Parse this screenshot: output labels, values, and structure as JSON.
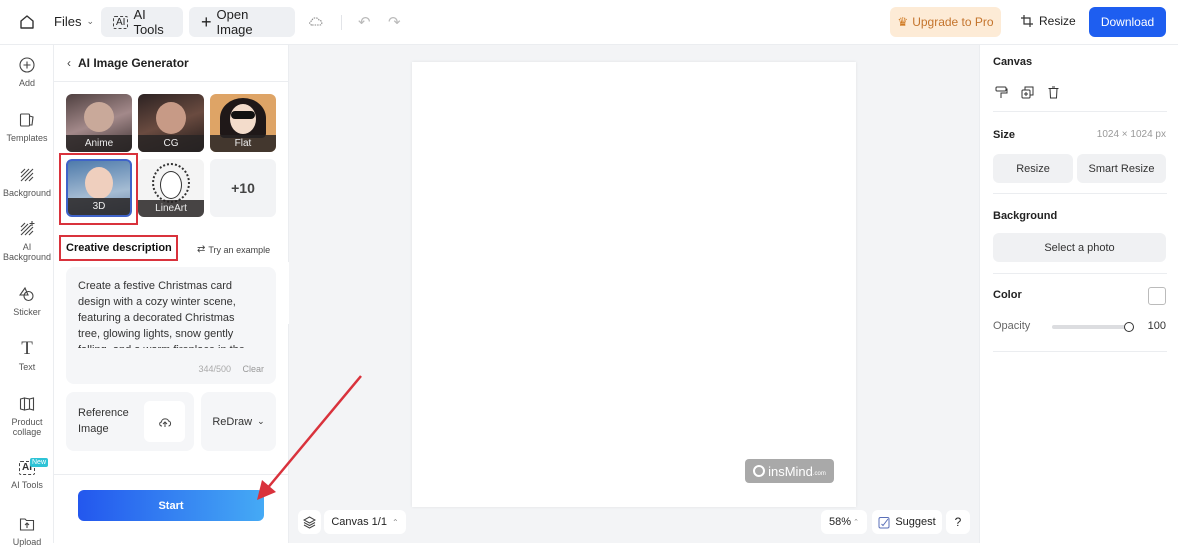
{
  "topbar": {
    "files_label": "Files",
    "ai_tools_label": "AI Tools",
    "open_image_label": "Open Image",
    "upgrade_label": "Upgrade to Pro",
    "resize_label": "Resize",
    "download_label": "Download"
  },
  "leftnav": {
    "items": [
      {
        "label": "Add",
        "icon": "plus-circle-icon"
      },
      {
        "label": "Templates",
        "icon": "templates-icon"
      },
      {
        "label": "Background",
        "icon": "background-icon"
      },
      {
        "label": "AI Background",
        "icon": "ai-background-icon"
      },
      {
        "label": "Sticker",
        "icon": "sticker-icon"
      },
      {
        "label": "Text",
        "icon": "text-icon"
      },
      {
        "label": "Product collage",
        "icon": "collage-icon"
      },
      {
        "label": "AI Tools",
        "icon": "ai-tools-icon",
        "badge": "New"
      },
      {
        "label": "Upload",
        "icon": "upload-icon"
      }
    ]
  },
  "panel": {
    "title": "AI Image Generator",
    "styles": [
      {
        "label": "Anime",
        "colors": [
          "#6b5a5a",
          "#a48c8c"
        ]
      },
      {
        "label": "CG",
        "colors": [
          "#3a2c2c",
          "#8e6a5c"
        ]
      },
      {
        "label": "Flat",
        "colors": [
          "#d9a06b",
          "#2a2020"
        ]
      },
      {
        "label": "3D",
        "colors": [
          "#5b87b4",
          "#d8c2b5"
        ],
        "selected": true
      },
      {
        "label": "LineArt",
        "colors": [
          "#ffffff",
          "#444444"
        ]
      }
    ],
    "more_label": "+10",
    "creative_label": "Creative description",
    "try_example_label": "Try an example",
    "description": "Create a festive Christmas card design with a cozy winter scene, featuring a decorated Christmas tree, glowing lights, snow gently falling, and a warm fireplace in the",
    "char_count": "344/500",
    "clear_label": "Clear",
    "reference_label": "Reference Image",
    "redraw_label": "ReDraw",
    "start_label": "Start"
  },
  "canvas": {
    "watermark": "insMind",
    "watermark_suffix": ".com",
    "page_label": "Canvas 1/1",
    "zoom_label": "58%",
    "suggest_label": "Suggest",
    "help_label": "?"
  },
  "rightpanel": {
    "canvas_title": "Canvas",
    "size_label": "Size",
    "size_value": "1024 × 1024 px",
    "resize_label": "Resize",
    "smart_resize_label": "Smart Resize",
    "background_label": "Background",
    "select_photo_label": "Select a photo",
    "color_label": "Color",
    "opacity_label": "Opacity",
    "opacity_value": "100"
  },
  "colors": {
    "accent": "#1e5ef0",
    "annotation_red": "#d9323c",
    "upgrade_bg": "#fdebd6",
    "upgrade_text": "#c4742c"
  }
}
